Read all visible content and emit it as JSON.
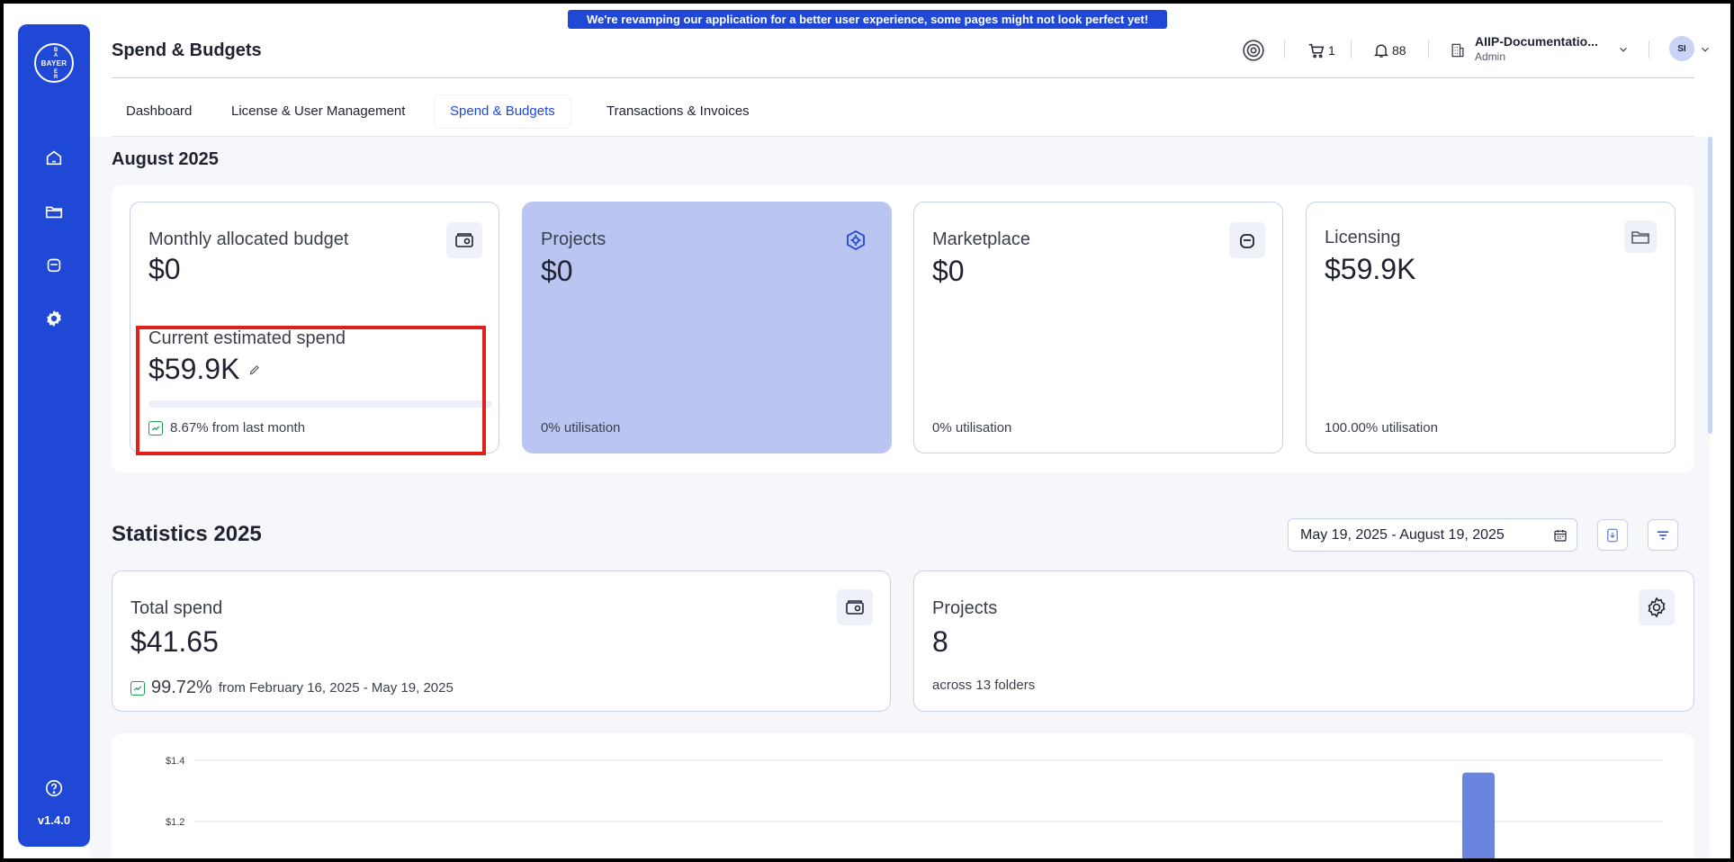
{
  "sidebar": {
    "logo_text": "BAYER",
    "items": [
      {
        "icon": "home-icon"
      },
      {
        "icon": "folder-icon"
      },
      {
        "icon": "bag-icon"
      },
      {
        "icon": "gear-icon"
      }
    ],
    "help_icon": "help-icon",
    "version": "v1.4.0"
  },
  "banner": {
    "text": "We're revamping our application for a better user experience, some pages might not look perfect yet!"
  },
  "header": {
    "title": "Spend & Budgets",
    "cart_count": "1",
    "notifications_count": "88",
    "org_name": "AIIP-Documentatio...",
    "org_role": "Admin",
    "avatar_initials": "SI"
  },
  "tabs": [
    {
      "label": "Dashboard"
    },
    {
      "label": "License & User Management"
    },
    {
      "label": "Spend & Budgets"
    },
    {
      "label": "Transactions & Invoices"
    }
  ],
  "month": {
    "title": "August 2025",
    "budget_card": {
      "title": "Monthly allocated budget",
      "value": "$0",
      "spend_title": "Current estimated spend",
      "spend_value": "$59.9K",
      "progress_fraction": 0,
      "trend_text": "8.67% from last month"
    },
    "projects_card": {
      "title": "Projects",
      "value": "$0",
      "utilisation": "0% utilisation"
    },
    "marketplace_card": {
      "title": "Marketplace",
      "value": "$0",
      "utilisation": "0% utilisation"
    },
    "licensing_card": {
      "title": "Licensing",
      "value": "$59.9K",
      "utilisation": "100.00% utilisation"
    }
  },
  "statistics": {
    "title": "Statistics 2025",
    "date_range": "May 19, 2025 - August 19, 2025",
    "total_spend": {
      "title": "Total spend",
      "value": "$41.65",
      "change_pct": "99.72%",
      "change_text": "from February 16, 2025 - May 19, 2025"
    },
    "projects": {
      "title": "Projects",
      "value": "8",
      "sub": "across 13 folders"
    }
  },
  "colors": {
    "brand": "#1f48d6",
    "highlight_card": "#bac6f1",
    "bar": "#6a85e0",
    "trend_green": "#1f9d4f",
    "alert_red": "#e0201c"
  },
  "chart_data": {
    "type": "bar",
    "y_ticks": [
      "$1.4",
      "$1.2"
    ],
    "visible_bar_value": 1.36,
    "ylim_visible": [
      1.2,
      1.4
    ]
  }
}
